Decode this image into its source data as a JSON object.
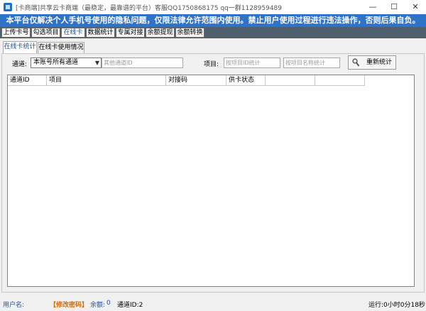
{
  "window": {
    "title": "[卡商端]共享云卡商端（最稳定，最靠谱的平台）客服QQ1750868175  qq一群1128959489",
    "minimize": "—",
    "maximize": "☐",
    "close": "✕"
  },
  "banner": "本平台仅解决个人手机号使用的隐私问题，仅限法律允许范围内使用。禁止用户使用过程进行违法操作，否则后果自负。",
  "main_tabs": [
    "上传卡号",
    "勾选项目",
    "在线卡",
    "数据统计",
    "专属对接",
    "余额提现",
    "余额转换"
  ],
  "main_tabs_active": "在线卡",
  "sub_tabs": [
    "在线卡统计",
    "在线卡使用情况"
  ],
  "sub_tabs_active": "在线卡统计",
  "filters": {
    "channel_label": "通道:",
    "channel_value": "本账号所有通道",
    "other_channel_placeholder": "其他通道ID",
    "project_label": "项目:",
    "project_id_placeholder": "按项目ID统计",
    "project_name_placeholder": "按项目名称统计",
    "refresh_label": "重新统计"
  },
  "table": {
    "columns": [
      "通道ID",
      "项目",
      "对接码",
      "供卡状态",
      "",
      ""
    ]
  },
  "status": {
    "user_label": "用户名:",
    "change_password": "【修改密码】",
    "balance_label": "余额:",
    "balance_value": "0",
    "channel_id": "通道ID:2",
    "runtime": "运行:0小时0分18秒"
  },
  "colors": {
    "banner_bg": "#2f73c8",
    "tabstrip_bg": "#4f5f6e",
    "accent_blue": "#1a4fa8",
    "link_orange": "#d46a00"
  }
}
